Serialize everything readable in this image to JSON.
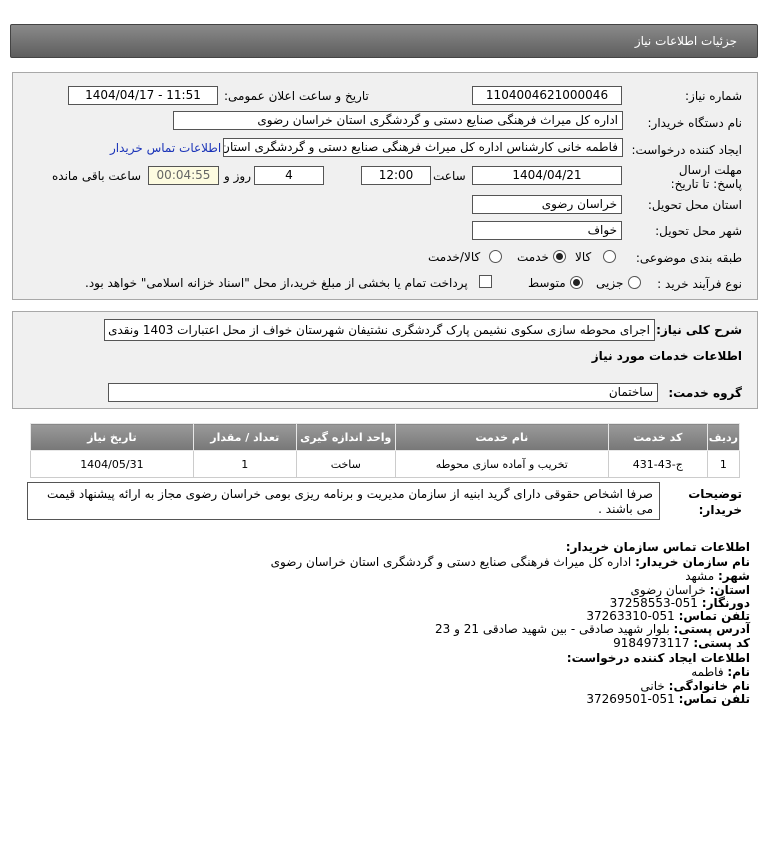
{
  "header": {
    "title": "جزئیات اطلاعات نیاز"
  },
  "form": {
    "need_number_label": "شماره نیاز:",
    "need_number": "1104004621000046",
    "announce_label": "تاریخ و ساعت اعلان عمومی:",
    "announce_value": "1404/04/17 - 11:51",
    "buyer_org_label": "نام دستگاه خریدار:",
    "buyer_org": "اداره کل میراث فرهنگی  صنایع دستی و گردشگری استان خراسان رضوی",
    "creator_label": "ایجاد کننده درخواست:",
    "creator": "فاطمه خانی کارشناس اداره کل میراث فرهنگی  صنایع دستی و گردشگری استان خراسان رضوی",
    "contact_link": "اطلاعات تماس خریدار",
    "deadline_label": "مهلت ارسال پاسخ: تا تاریخ:",
    "deadline_date": "1404/04/21",
    "time_label": "ساعت",
    "deadline_time": "12:00",
    "days_value": "4",
    "days_label": "روز و",
    "remaining_time": "00:04:55",
    "remaining_label": "ساعت باقی مانده",
    "province_label": "استان محل تحویل:",
    "province": "خراسان رضوی",
    "city_label": "شهر محل تحویل:",
    "city": "خواف",
    "category_label": "طبقه بندی موضوعی:",
    "category_options": [
      "کالا",
      "خدمت",
      "کالا/خدمت"
    ],
    "category_selected": "خدمت",
    "process_label": "نوع فرآیند خرید :",
    "process_options": [
      "جزیی",
      "متوسط"
    ],
    "process_selected": "متوسط",
    "treasury_text": "پرداخت تمام یا بخشی از مبلغ خرید،از محل \"اسناد خزانه اسلامی\" خواهد بود."
  },
  "summary": {
    "label": "شرح کلی نیاز:",
    "text": "اجرای محوطه سازی سکوی نشیمن پارک گردشگری نشتیفان شهرستان خواف از محل اعتبارات 1403 ونقدی",
    "services_title": "اطلاعات خدمات مورد نیاز",
    "group_label": "گروه خدمت:",
    "group_value": "ساختمان"
  },
  "table": {
    "headers": [
      "ردیف",
      "کد خدمت",
      "نام خدمت",
      "واحد اندازه گیری",
      "تعداد / مقدار",
      "تاریخ نیاز"
    ],
    "rows": [
      [
        "1",
        "ج-43-431",
        "تخریب و آماده سازی محوطه",
        "ساخت",
        "1",
        "1404/05/31"
      ]
    ]
  },
  "notes": {
    "label": "توضیحات خریدار:",
    "text": "صرفا اشخاص حقوقی دارای گرید ابنیه از سازمان مدیریت و برنامه ریزی بومی خراسان رضوی مجاز به ارائه پیشنهاد قیمت می باشند ."
  },
  "contact": {
    "title": "اطلاعات تماس سازمان خریدار:",
    "org_label": "نام سازمان خریدار:",
    "org": "اداره کل میراث فرهنگی صنایع دستی و گردشگری استان خراسان رضوی",
    "city_label": "شهر:",
    "city": "مشهد",
    "province_label": "استان:",
    "province": "خراسان رضوی",
    "fax_label": "دورنگار:",
    "fax": "051-37258553",
    "phone_label": "تلفن تماس:",
    "phone": "051-37263310",
    "address_label": "آدرس پستی:",
    "address": "بلوار شهید صادقی - بین شهید صادقی 21 و 23",
    "postal_label": "کد پستی:",
    "postal": "9184973117",
    "creator_title": "اطلاعات ایجاد کننده درخواست:",
    "first_name_label": "نام:",
    "first_name": "فاطمه",
    "last_name_label": "نام خانوادگی:",
    "last_name": "خانی",
    "creator_phone_label": "تلفن تماس:",
    "creator_phone": "051-37269501"
  }
}
